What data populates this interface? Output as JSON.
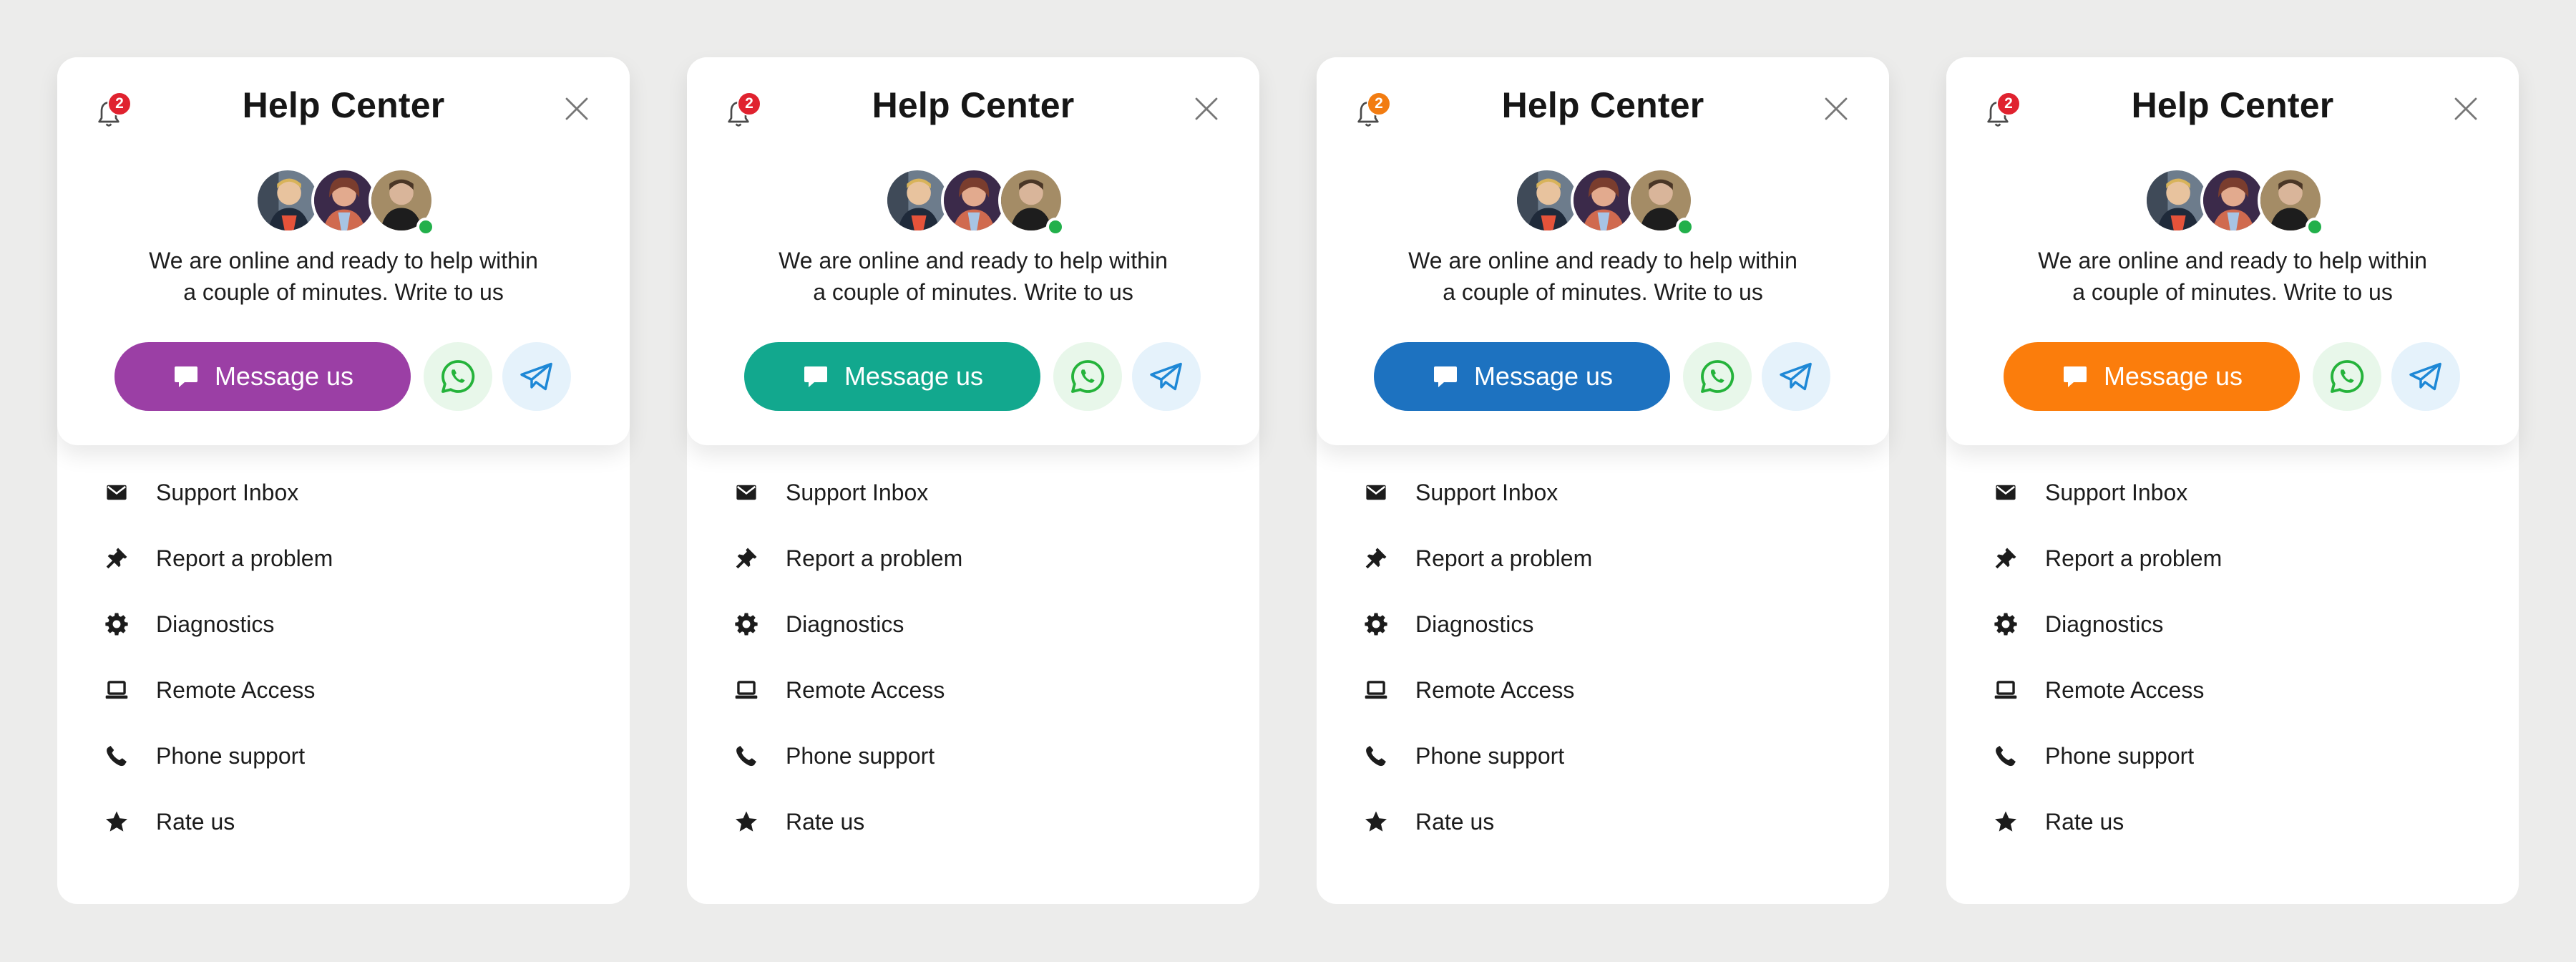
{
  "widgets": [
    {
      "accent": "#9b3fa5",
      "badge_color": "#e0222f"
    },
    {
      "accent": "#12a88e",
      "badge_color": "#e0222f"
    },
    {
      "accent": "#1d72c0",
      "badge_color": "#f27c11"
    },
    {
      "accent": "#fb7d0c",
      "badge_color": "#e0222f"
    }
  ],
  "common": {
    "title": "Help Center",
    "notification_count": "2",
    "description_line1": "We are online and ready to help within",
    "description_line2": "a couple of minutes. Write to us",
    "message_label": "Message us",
    "whatsapp_icon": "whatsapp-icon",
    "telegram_icon": "telegram-icon",
    "whatsapp_color": "#25b33b",
    "telegram_color": "#1e88d6",
    "online_color": "#22b04b",
    "menu": [
      {
        "label": "Support Inbox",
        "icon": "envelope-icon"
      },
      {
        "label": "Report a problem",
        "icon": "pin-icon"
      },
      {
        "label": "Diagnostics",
        "icon": "gear-icon"
      },
      {
        "label": "Remote Access",
        "icon": "laptop-icon"
      },
      {
        "label": "Phone support",
        "icon": "phone-icon"
      },
      {
        "label": "Rate us",
        "icon": "star-icon"
      }
    ]
  }
}
